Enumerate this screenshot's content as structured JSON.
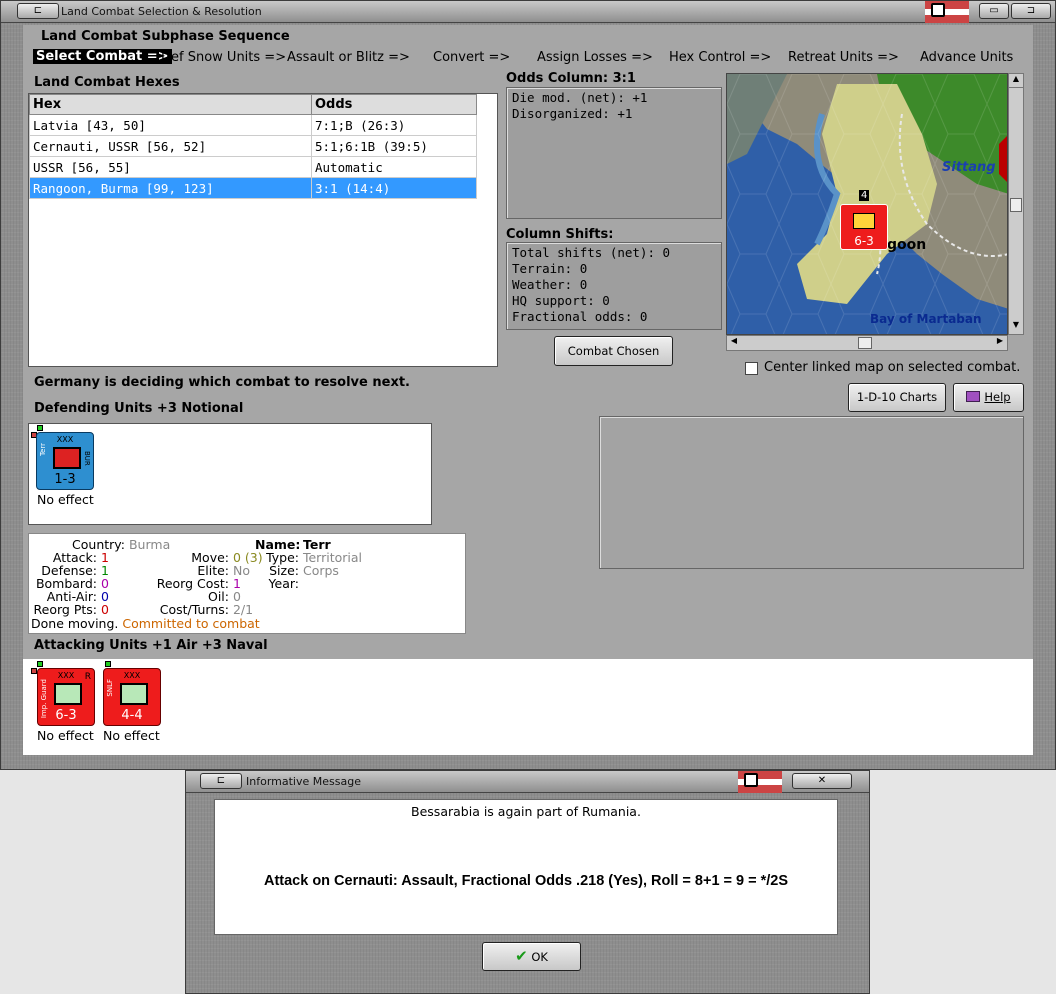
{
  "main_window": {
    "title": "Land Combat Selection & Resolution",
    "subphase_header": "Land Combat Subphase Sequence",
    "sequence": [
      {
        "label": "Select Combat =>",
        "selected": true
      },
      {
        "label": "Def Snow Units =>"
      },
      {
        "label": "Assault or Blitz =>"
      },
      {
        "label": "Convert =>"
      },
      {
        "label": "Assign Losses =>"
      },
      {
        "label": "Hex Control =>"
      },
      {
        "label": "Retreat Units =>"
      },
      {
        "label": "Advance Units"
      }
    ],
    "hexes_header": "Land Combat Hexes",
    "table": {
      "columns": [
        "Hex",
        "Odds"
      ],
      "rows": [
        {
          "hex": "Latvia [43, 50]",
          "odds": "7:1;B (26:3)"
        },
        {
          "hex": "Cernauti, USSR [56, 52]",
          "odds": "5:1;6:1B (39:5)"
        },
        {
          "hex": "USSR [56, 55]",
          "odds": "Automatic"
        },
        {
          "hex": "Rangoon, Burma [99, 123]",
          "odds": "3:1 (14:4)",
          "selected": true
        }
      ]
    },
    "odds_column": {
      "label": "Odds Column: 3:1",
      "lines": [
        "Die mod. (net): +1",
        "Disorganized: +1"
      ]
    },
    "column_shifts": {
      "label": "Column Shifts:",
      "lines": [
        "Total shifts (net): 0",
        "Terrain: 0",
        "Weather: 0",
        "HQ support: 0",
        "Fractional odds: 0"
      ]
    },
    "combat_chosen_button": "Combat Chosen",
    "map": {
      "labels": [
        "Sittang",
        "goon",
        "Bay of Martaban"
      ],
      "unit_value": "6-3",
      "stack_count": "4"
    },
    "center_map_checkbox": {
      "label": "Center linked map on selected combat.",
      "checked": false
    },
    "status_text": "Germany is deciding which combat to resolve next.",
    "charts_button": "1-D-10 Charts",
    "help_button": "Help",
    "defending_header": "Defending Units +3 Notional",
    "defending_units": [
      {
        "value": "1-3",
        "side": "Terr",
        "nat": "BUR",
        "top": "XXX",
        "result": "No effect",
        "color": "#2e8fd0"
      }
    ],
    "unit_info": {
      "country_label": "Country:",
      "country": "Burma",
      "attack_label": "Attack:",
      "attack": "1",
      "defense_label": "Defense:",
      "defense": "1",
      "bombard_label": "Bombard:",
      "bombard": "0",
      "antiair_label": "Anti-Air:",
      "antiair": "0",
      "reorgpts_label": "Reorg Pts:",
      "reorgpts": "0",
      "move_label": "Move:",
      "move": "0 (3)",
      "elite_label": "Elite:",
      "elite": "No",
      "reorgcost_label": "Reorg Cost:",
      "reorgcost": "1",
      "oil_label": "Oil:",
      "oil": "0",
      "costturns_label": "Cost/Turns:",
      "costturns": "2/1",
      "name_label": "Name:",
      "name": "Terr",
      "type_label": "Type:",
      "type": "Territorial",
      "size_label": "Size:",
      "size": "Corps",
      "year_label": "Year:",
      "year": "",
      "status1": "Done moving.",
      "status2": "Committed to combat"
    },
    "attacking_header": "Attacking Units +1 Air +3 Naval",
    "attacking_units": [
      {
        "value": "6-3",
        "side": "Imp. Guard",
        "top": "XXX",
        "corner": "R",
        "result": "No effect",
        "color": "#ee1c1c"
      },
      {
        "value": "4-4",
        "side": "SNLF",
        "top": "XXX",
        "corner": "",
        "result": "No effect",
        "color": "#ee1c1c"
      }
    ]
  },
  "message_window": {
    "title": "Informative Message",
    "line1": "Bessarabia is again part of Rumania.",
    "line2": "Attack on Cernauti: Assault, Fractional Odds .218 (Yes), Roll = 8+1 = 9 = */2S",
    "ok_button": "OK"
  },
  "colors": {
    "selection": "#3399ff",
    "attacker": "#ee1c1c",
    "defender": "#2e8fd0"
  }
}
